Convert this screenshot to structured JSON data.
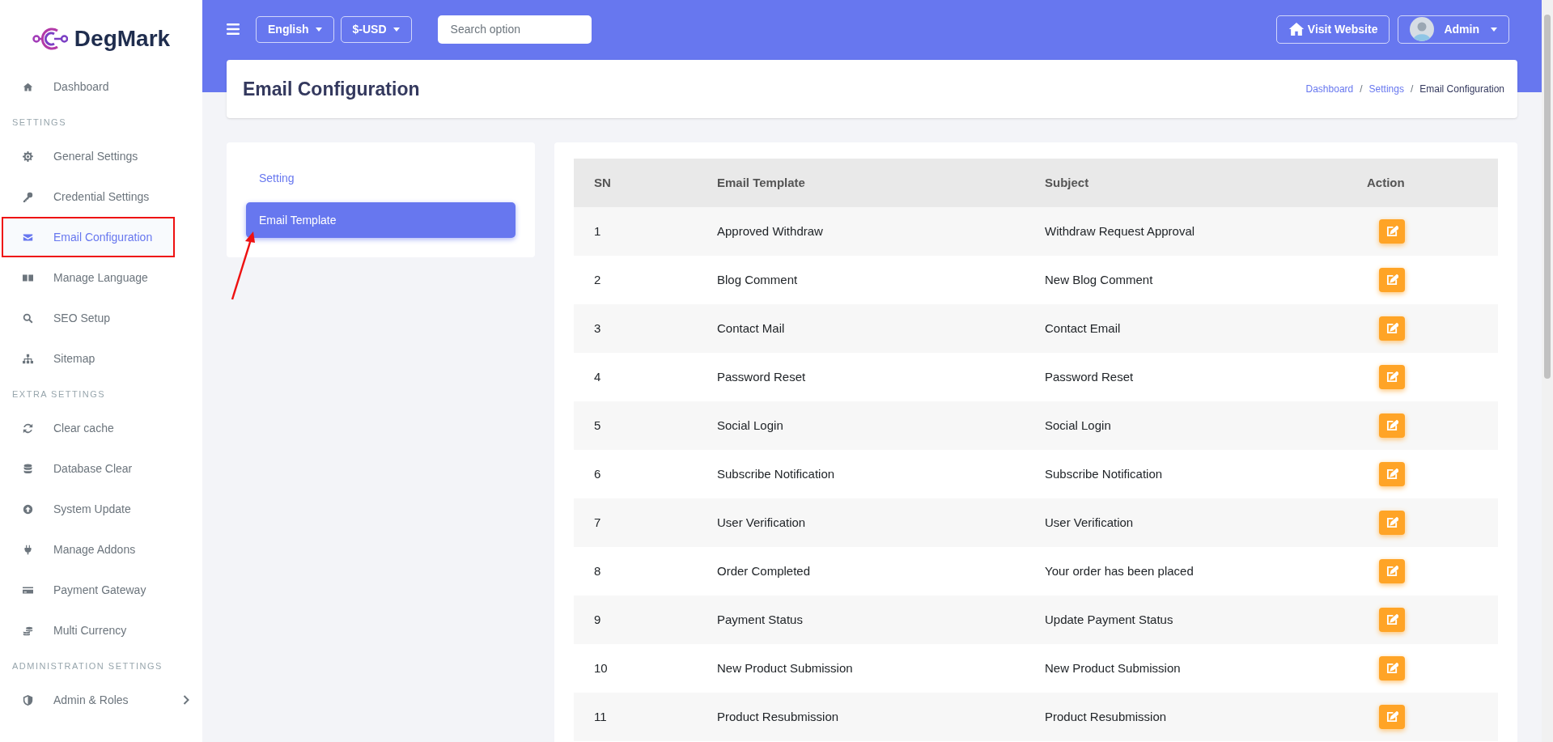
{
  "brand": {
    "name": "DegMark"
  },
  "sidebar": {
    "sections": [
      {
        "items": [
          {
            "label": "Dashboard",
            "selected": false
          }
        ]
      },
      {
        "heading": "SETTINGS",
        "items": [
          {
            "label": "General Settings",
            "selected": false
          },
          {
            "label": "Credential Settings",
            "selected": false
          },
          {
            "label": "Email Configuration",
            "selected": true,
            "outlined": true
          },
          {
            "label": "Manage Language",
            "selected": false
          },
          {
            "label": "SEO Setup",
            "selected": false
          },
          {
            "label": "Sitemap",
            "selected": false
          }
        ]
      },
      {
        "heading": "EXTRA SETTINGS",
        "items": [
          {
            "label": "Clear cache",
            "selected": false
          },
          {
            "label": "Database Clear",
            "selected": false
          },
          {
            "label": "System Update",
            "selected": false
          },
          {
            "label": "Manage Addons",
            "selected": false
          },
          {
            "label": "Payment Gateway",
            "selected": false
          },
          {
            "label": "Multi Currency",
            "selected": false
          }
        ]
      },
      {
        "heading": "ADMINISTRATION SETTINGS",
        "items": [
          {
            "label": "Admin & Roles",
            "selected": false,
            "expandable": true
          }
        ]
      }
    ]
  },
  "topbar": {
    "language": "English",
    "currency": "$-USD",
    "search": {
      "placeholder": "Search option"
    },
    "visit_website": "Visit Website",
    "user": "Admin"
  },
  "page": {
    "title": "Email Configuration",
    "breadcrumb_separator": "/",
    "breadcrumb": [
      {
        "label": "Dashboard",
        "link": true
      },
      {
        "label": "Settings",
        "link": true
      },
      {
        "label": "Email Configuration",
        "link": false
      }
    ]
  },
  "settings_menu": [
    {
      "label": "Setting",
      "selected": false
    },
    {
      "label": "Email Template",
      "selected": true,
      "pointed": true
    }
  ],
  "table": {
    "columns": [
      "SN",
      "Email Template",
      "Subject",
      "Action"
    ],
    "rows": [
      {
        "sn": "1",
        "template": "Approved Withdraw",
        "subject": "Withdraw Request Approval"
      },
      {
        "sn": "2",
        "template": "Blog Comment",
        "subject": "New Blog Comment"
      },
      {
        "sn": "3",
        "template": "Contact Mail",
        "subject": "Contact Email"
      },
      {
        "sn": "4",
        "template": "Password Reset",
        "subject": "Password Reset"
      },
      {
        "sn": "5",
        "template": "Social Login",
        "subject": "Social Login"
      },
      {
        "sn": "6",
        "template": "Subscribe Notification",
        "subject": "Subscribe Notification"
      },
      {
        "sn": "7",
        "template": "User Verification",
        "subject": "User Verification"
      },
      {
        "sn": "8",
        "template": "Order Completed",
        "subject": "Your order has been placed"
      },
      {
        "sn": "9",
        "template": "Payment Status",
        "subject": "Update Payment Status"
      },
      {
        "sn": "10",
        "template": "New Product Submission",
        "subject": "New Product Submission"
      },
      {
        "sn": "11",
        "template": "Product Resubmission",
        "subject": "Product Resubmission"
      }
    ]
  }
}
